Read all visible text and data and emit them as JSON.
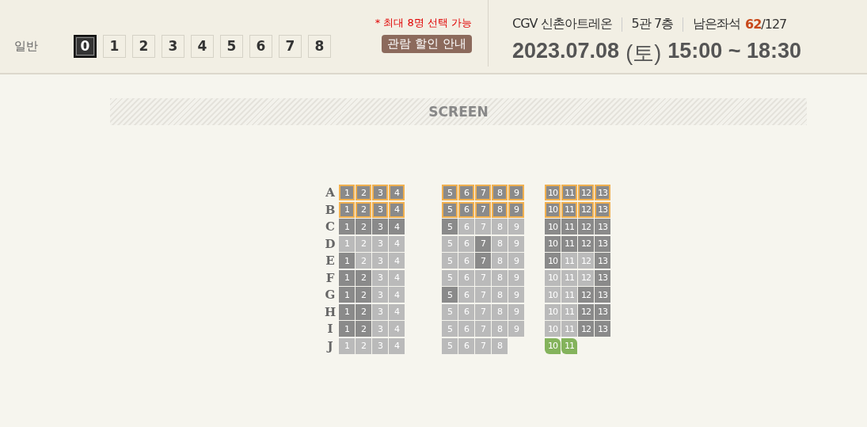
{
  "header": {
    "audience_label": "일반",
    "quantities": [
      {
        "label": "0",
        "selected": true
      },
      {
        "label": "1",
        "selected": false
      },
      {
        "label": "2",
        "selected": false
      },
      {
        "label": "3",
        "selected": false
      },
      {
        "label": "4",
        "selected": false
      },
      {
        "label": "5",
        "selected": false
      },
      {
        "label": "6",
        "selected": false
      },
      {
        "label": "7",
        "selected": false
      },
      {
        "label": "8",
        "selected": false
      }
    ],
    "max_note": "* 최대 8명 선택 가능",
    "discount_button": "관람 할인 안내",
    "theater": "CGV 신촌아트레온",
    "hall": "5관 7층",
    "remaining_label": "남은좌석",
    "remaining": "62",
    "total": "/127",
    "date": "2023.07.08",
    "weekday": "(토)",
    "time": "15:00 ~ 18:30"
  },
  "screen": "SCREEN",
  "rows": [
    {
      "label": "A",
      "sections": [
        [
          {
            "label": "1",
            "kind": "prime"
          },
          {
            "label": "2",
            "kind": "prime"
          },
          {
            "label": "3",
            "kind": "prime"
          },
          {
            "label": "4",
            "kind": "prime"
          }
        ],
        [
          {
            "label": "5",
            "kind": "prime"
          },
          {
            "label": "6",
            "kind": "prime"
          },
          {
            "label": "7",
            "kind": "prime"
          },
          {
            "label": "8",
            "kind": "prime"
          },
          {
            "label": "9",
            "kind": "prime"
          }
        ],
        [
          {
            "label": "10",
            "kind": "prime"
          },
          {
            "label": "11",
            "kind": "prime"
          },
          {
            "label": "12",
            "kind": "prime"
          },
          {
            "label": "13",
            "kind": "prime"
          }
        ]
      ]
    },
    {
      "label": "B",
      "sections": [
        [
          {
            "label": "1",
            "kind": "prime"
          },
          {
            "label": "2",
            "kind": "prime"
          },
          {
            "label": "3",
            "kind": "prime"
          },
          {
            "label": "4",
            "kind": "prime"
          }
        ],
        [
          {
            "label": "5",
            "kind": "prime"
          },
          {
            "label": "6",
            "kind": "prime"
          },
          {
            "label": "7",
            "kind": "prime"
          },
          {
            "label": "8",
            "kind": "prime"
          },
          {
            "label": "9",
            "kind": "prime"
          }
        ],
        [
          {
            "label": "10",
            "kind": "prime"
          },
          {
            "label": "11",
            "kind": "prime"
          },
          {
            "label": "12",
            "kind": "prime"
          },
          {
            "label": "13",
            "kind": "prime"
          }
        ]
      ]
    },
    {
      "label": "C",
      "sections": [
        [
          {
            "label": "1",
            "kind": "standard"
          },
          {
            "label": "2",
            "kind": "standard"
          },
          {
            "label": "3",
            "kind": "standard"
          },
          {
            "label": "4",
            "kind": "standard"
          }
        ],
        [
          {
            "label": "5",
            "kind": "standard"
          },
          {
            "label": "6",
            "kind": "sold"
          },
          {
            "label": "7",
            "kind": "sold"
          },
          {
            "label": "8",
            "kind": "sold"
          },
          {
            "label": "9",
            "kind": "sold"
          }
        ],
        [
          {
            "label": "10",
            "kind": "standard"
          },
          {
            "label": "11",
            "kind": "standard"
          },
          {
            "label": "12",
            "kind": "standard"
          },
          {
            "label": "13",
            "kind": "standard"
          }
        ]
      ]
    },
    {
      "label": "D",
      "sections": [
        [
          {
            "label": "1",
            "kind": "sold"
          },
          {
            "label": "2",
            "kind": "sold"
          },
          {
            "label": "3",
            "kind": "sold"
          },
          {
            "label": "4",
            "kind": "sold"
          }
        ],
        [
          {
            "label": "5",
            "kind": "sold"
          },
          {
            "label": "6",
            "kind": "sold"
          },
          {
            "label": "7",
            "kind": "standard"
          },
          {
            "label": "8",
            "kind": "sold"
          },
          {
            "label": "9",
            "kind": "sold"
          }
        ],
        [
          {
            "label": "10",
            "kind": "standard"
          },
          {
            "label": "11",
            "kind": "standard"
          },
          {
            "label": "12",
            "kind": "standard"
          },
          {
            "label": "13",
            "kind": "standard"
          }
        ]
      ]
    },
    {
      "label": "E",
      "sections": [
        [
          {
            "label": "1",
            "kind": "standard"
          },
          {
            "label": "2",
            "kind": "sold"
          },
          {
            "label": "3",
            "kind": "sold"
          },
          {
            "label": "4",
            "kind": "sold"
          }
        ],
        [
          {
            "label": "5",
            "kind": "sold"
          },
          {
            "label": "6",
            "kind": "sold"
          },
          {
            "label": "7",
            "kind": "standard"
          },
          {
            "label": "8",
            "kind": "sold"
          },
          {
            "label": "9",
            "kind": "sold"
          }
        ],
        [
          {
            "label": "10",
            "kind": "standard"
          },
          {
            "label": "11",
            "kind": "sold"
          },
          {
            "label": "12",
            "kind": "sold"
          },
          {
            "label": "13",
            "kind": "standard"
          }
        ]
      ]
    },
    {
      "label": "F",
      "sections": [
        [
          {
            "label": "1",
            "kind": "standard"
          },
          {
            "label": "2",
            "kind": "standard"
          },
          {
            "label": "3",
            "kind": "sold"
          },
          {
            "label": "4",
            "kind": "sold"
          }
        ],
        [
          {
            "label": "5",
            "kind": "sold"
          },
          {
            "label": "6",
            "kind": "sold"
          },
          {
            "label": "7",
            "kind": "sold"
          },
          {
            "label": "8",
            "kind": "sold"
          },
          {
            "label": "9",
            "kind": "sold"
          }
        ],
        [
          {
            "label": "10",
            "kind": "sold"
          },
          {
            "label": "11",
            "kind": "sold"
          },
          {
            "label": "12",
            "kind": "sold"
          },
          {
            "label": "13",
            "kind": "standard"
          }
        ]
      ]
    },
    {
      "label": "G",
      "sections": [
        [
          {
            "label": "1",
            "kind": "standard"
          },
          {
            "label": "2",
            "kind": "standard"
          },
          {
            "label": "3",
            "kind": "sold"
          },
          {
            "label": "4",
            "kind": "sold"
          }
        ],
        [
          {
            "label": "5",
            "kind": "standard"
          },
          {
            "label": "6",
            "kind": "sold"
          },
          {
            "label": "7",
            "kind": "sold"
          },
          {
            "label": "8",
            "kind": "sold"
          },
          {
            "label": "9",
            "kind": "sold"
          }
        ],
        [
          {
            "label": "10",
            "kind": "sold"
          },
          {
            "label": "11",
            "kind": "sold"
          },
          {
            "label": "12",
            "kind": "standard"
          },
          {
            "label": "13",
            "kind": "standard"
          }
        ]
      ]
    },
    {
      "label": "H",
      "sections": [
        [
          {
            "label": "1",
            "kind": "standard"
          },
          {
            "label": "2",
            "kind": "standard"
          },
          {
            "label": "3",
            "kind": "sold"
          },
          {
            "label": "4",
            "kind": "sold"
          }
        ],
        [
          {
            "label": "5",
            "kind": "sold"
          },
          {
            "label": "6",
            "kind": "sold"
          },
          {
            "label": "7",
            "kind": "sold"
          },
          {
            "label": "8",
            "kind": "sold"
          },
          {
            "label": "9",
            "kind": "sold"
          }
        ],
        [
          {
            "label": "10",
            "kind": "sold"
          },
          {
            "label": "11",
            "kind": "sold"
          },
          {
            "label": "12",
            "kind": "standard"
          },
          {
            "label": "13",
            "kind": "standard"
          }
        ]
      ]
    },
    {
      "label": "I",
      "sections": [
        [
          {
            "label": "1",
            "kind": "standard"
          },
          {
            "label": "2",
            "kind": "standard"
          },
          {
            "label": "3",
            "kind": "sold"
          },
          {
            "label": "4",
            "kind": "sold"
          }
        ],
        [
          {
            "label": "5",
            "kind": "sold"
          },
          {
            "label": "6",
            "kind": "sold"
          },
          {
            "label": "7",
            "kind": "sold"
          },
          {
            "label": "8",
            "kind": "sold"
          },
          {
            "label": "9",
            "kind": "sold"
          }
        ],
        [
          {
            "label": "10",
            "kind": "sold"
          },
          {
            "label": "11",
            "kind": "sold"
          },
          {
            "label": "12",
            "kind": "standard"
          },
          {
            "label": "13",
            "kind": "standard"
          }
        ]
      ]
    },
    {
      "label": "J",
      "sections": [
        [
          {
            "label": "1",
            "kind": "sold"
          },
          {
            "label": "2",
            "kind": "sold"
          },
          {
            "label": "3",
            "kind": "sold"
          },
          {
            "label": "4",
            "kind": "sold"
          }
        ],
        [
          {
            "label": "5",
            "kind": "sold"
          },
          {
            "label": "6",
            "kind": "sold"
          },
          {
            "label": "7",
            "kind": "sold"
          },
          {
            "label": "8",
            "kind": "sold"
          }
        ],
        [
          {
            "label": "10",
            "kind": "special"
          },
          {
            "label": "11",
            "kind": "special"
          }
        ]
      ]
    }
  ]
}
